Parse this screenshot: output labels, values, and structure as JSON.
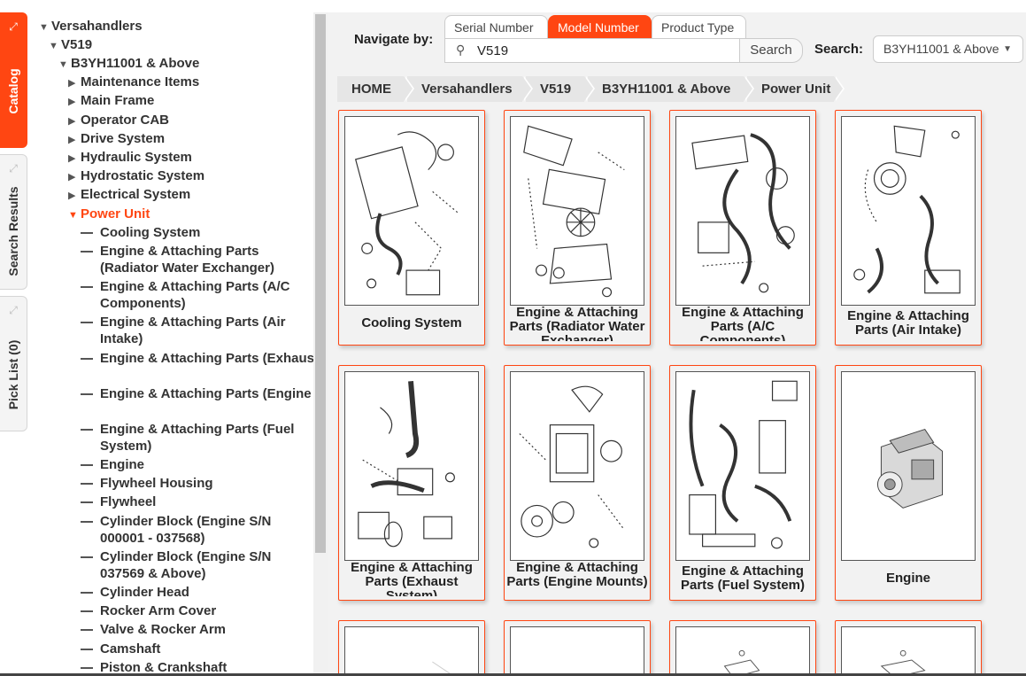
{
  "side_tabs": {
    "catalog": "Catalog",
    "search_results": "Search Results",
    "pick_list": "Pick List (0)"
  },
  "tree": {
    "root": "Versahandlers",
    "model": "V519",
    "serial_range": "B3YH11001 & Above",
    "sections": [
      "Maintenance Items",
      "Main Frame",
      "Operator CAB",
      "Drive System",
      "Hydraulic System",
      "Hydrostatic System",
      "Electrical System"
    ],
    "current": "Power Unit",
    "leaves": [
      "Cooling System",
      "Engine & Attaching Parts (Radiator Water Exchanger)",
      "Engine & Attaching Parts (A/C Components)",
      "Engine & Attaching Parts (Air Intake)",
      "Engine & Attaching Parts (Exhaust System)",
      "Engine & Attaching Parts (Engine Mounts)",
      "Engine & Attaching Parts (Fuel System)",
      "Engine",
      "Flywheel Housing",
      "Flywheel",
      "Cylinder Block (Engine S/N 000001 - 037568)",
      "Cylinder Block (Engine S/N 037569 & Above)",
      "Cylinder Head",
      "Rocker Arm Cover",
      "Valve & Rocker Arm",
      "Camshaft",
      "Piston & Crankshaft"
    ]
  },
  "navigate": {
    "label": "Navigate by:",
    "tabs": [
      "Serial Number",
      "Model Number",
      "Product Type"
    ],
    "active_tab": "Model Number",
    "search_value": "V519",
    "search_button": "Search",
    "search_label": "Search:",
    "search_select": "B3YH11001 & Above"
  },
  "breadcrumb": [
    "HOME",
    "Versahandlers",
    "V519",
    "B3YH11001 & Above",
    "Power Unit"
  ],
  "cards": [
    {
      "title": "Cooling System"
    },
    {
      "title": "Engine & Attaching Parts (Radiator Water Exchanger)"
    },
    {
      "title": "Engine & Attaching Parts (A/C Components)"
    },
    {
      "title": "Engine & Attaching Parts (Air Intake)"
    },
    {
      "title": "Engine & Attaching Parts (Exhaust System)"
    },
    {
      "title": "Engine & Attaching Parts (Engine Mounts)"
    },
    {
      "title": "Engine & Attaching Parts (Fuel System)"
    },
    {
      "title": "Engine"
    },
    {
      "title": ""
    },
    {
      "title": ""
    },
    {
      "title": ""
    },
    {
      "title": ""
    }
  ],
  "colors": {
    "accent": "#ff4612",
    "panel": "#f2f2f2",
    "crumb": "#e6e6e6"
  }
}
